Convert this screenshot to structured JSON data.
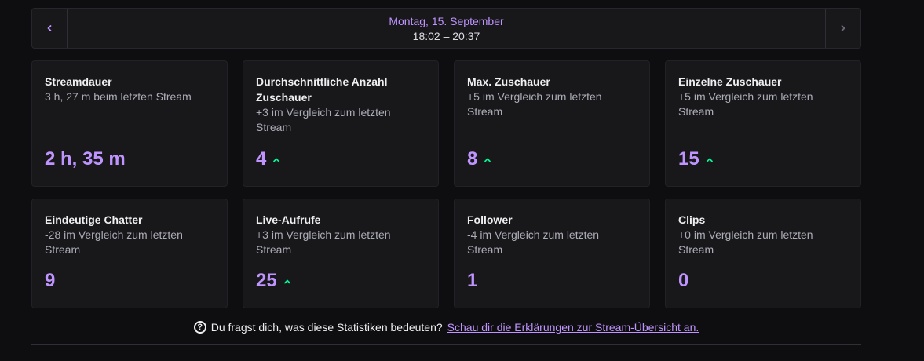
{
  "header": {
    "date": "Montag, 15. September",
    "time": "18:02 – 20:37"
  },
  "colors": {
    "accent": "#bf94ff",
    "up": "#00f593",
    "background": "#0e0e10",
    "card": "#18181b"
  },
  "stats": [
    {
      "title": "Streamdauer",
      "subtitle": "3 h, 27 m beim letzten Stream",
      "value": "2 h, 35 m",
      "trend": "none"
    },
    {
      "title": "Durchschnittliche Anzahl Zuschauer",
      "subtitle": "+3 im Vergleich zum letzten Stream",
      "value": "4",
      "trend": "up"
    },
    {
      "title": "Max. Zuschauer",
      "subtitle": "+5 im Vergleich zum letzten Stream",
      "value": "8",
      "trend": "up"
    },
    {
      "title": "Einzelne Zuschauer",
      "subtitle": "+5 im Vergleich zum letzten Stream",
      "value": "15",
      "trend": "up"
    },
    {
      "title": "Eindeutige Chatter",
      "subtitle": "-28 im Vergleich zum letzten Stream",
      "value": "9",
      "trend": "none"
    },
    {
      "title": "Live-Aufrufe",
      "subtitle": "+3 im Vergleich zum letzten Stream",
      "value": "25",
      "trend": "up"
    },
    {
      "title": "Follower",
      "subtitle": "-4 im Vergleich zum letzten Stream",
      "value": "1",
      "trend": "none"
    },
    {
      "title": "Clips",
      "subtitle": "+0 im Vergleich zum letzten Stream",
      "value": "0",
      "trend": "none"
    }
  ],
  "footer": {
    "question": "Du fragst dich, was diese Statistiken bedeuten?",
    "link": "Schau dir die Erklärungen zur Stream-Übersicht an."
  }
}
